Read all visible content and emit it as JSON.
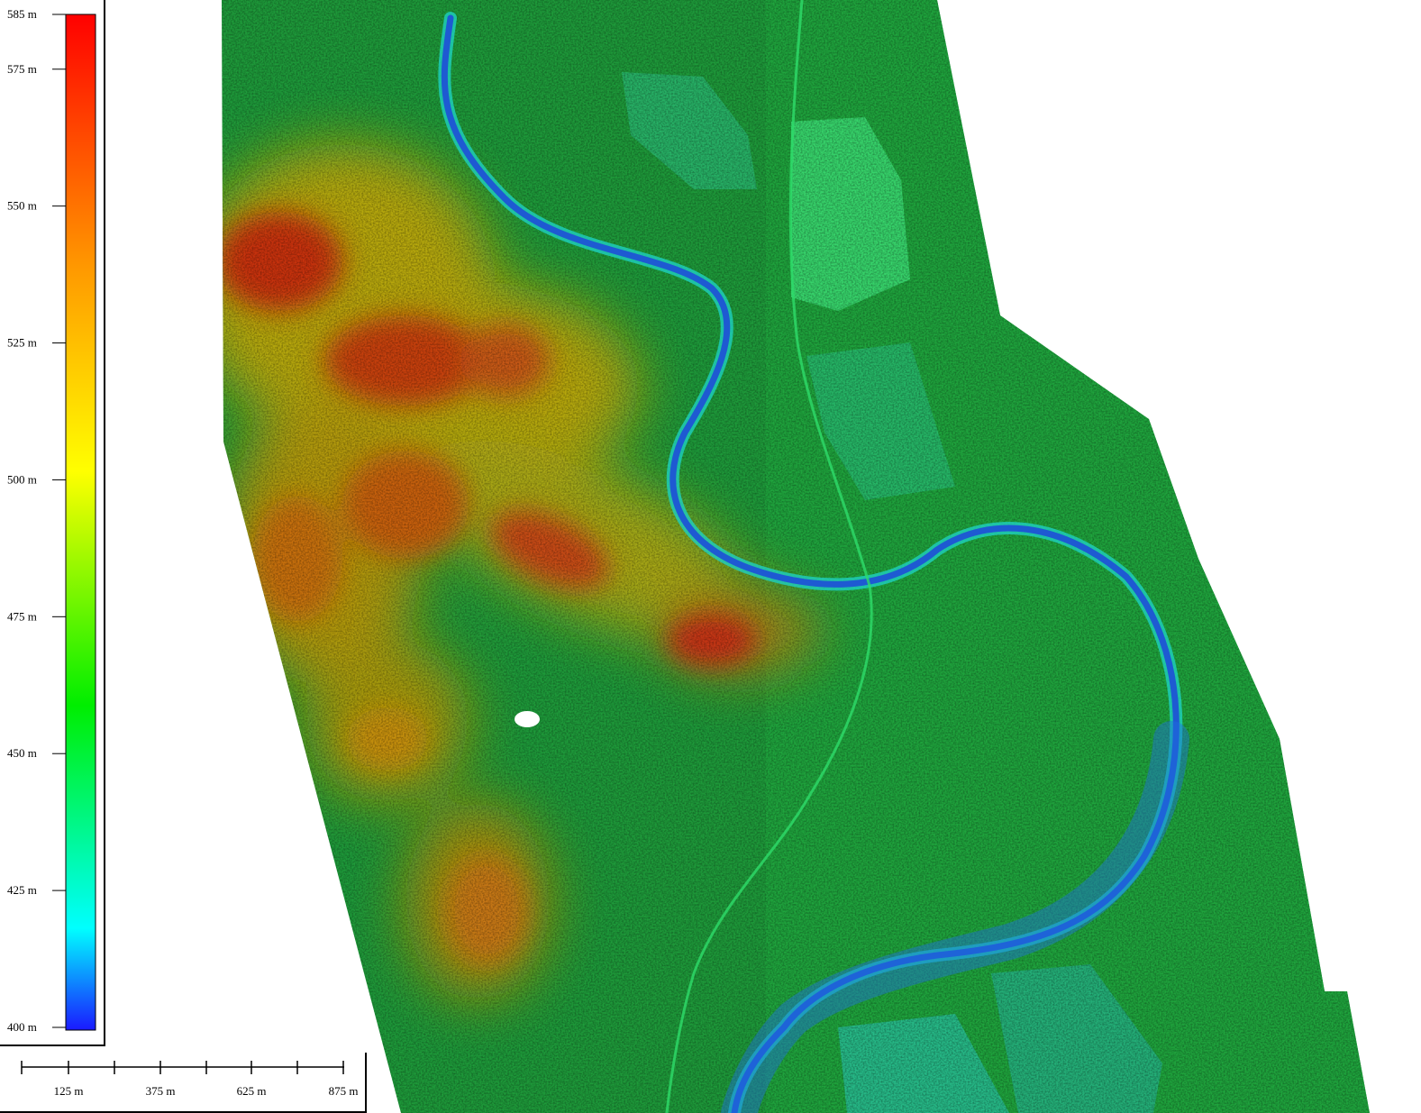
{
  "elevation_legend": {
    "unit": "m",
    "min": 400,
    "max": 585,
    "ticks": [
      {
        "value": 585,
        "label": "585 m"
      },
      {
        "value": 575,
        "label": "575 m"
      },
      {
        "value": 550,
        "label": "550 m"
      },
      {
        "value": 525,
        "label": "525 m"
      },
      {
        "value": 500,
        "label": "500 m"
      },
      {
        "value": 475,
        "label": "475 m"
      },
      {
        "value": 450,
        "label": "450 m"
      },
      {
        "value": 425,
        "label": "425 m"
      },
      {
        "value": 400,
        "label": "400 m"
      }
    ],
    "colors": [
      "#1a1aff",
      "#00ffff",
      "#00ff00",
      "#ffff00",
      "#ff8000",
      "#ff0000"
    ]
  },
  "scale_bar": {
    "labels": [
      "125 m",
      "375 m",
      "625 m",
      "875 m"
    ]
  },
  "map": {
    "palette": {
      "river": "#1e5ad2",
      "water_edge": "#00c8c8",
      "lowland": "#1ea03c",
      "highland": "#c8b400",
      "peak": "#d22814",
      "field": "#3cdc6e",
      "meadow": "#28c8a0"
    }
  }
}
